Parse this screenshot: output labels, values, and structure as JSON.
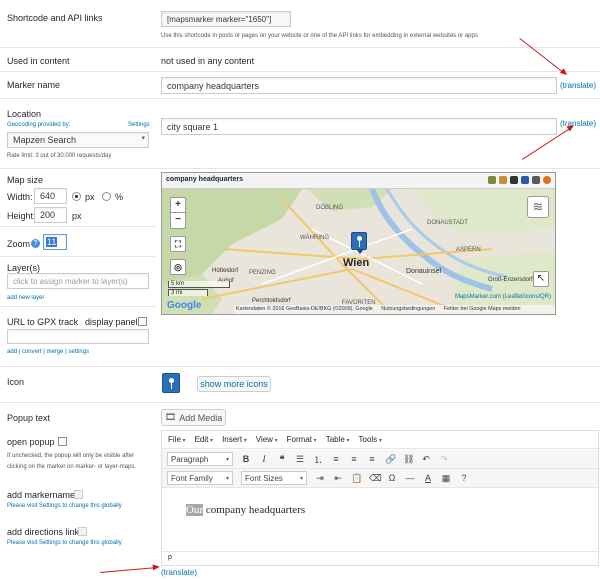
{
  "shortcode": {
    "label": "Shortcode and API links",
    "value": "[mapsmarker marker=\"1650\"]",
    "help": "Use this shortcode in posts or pages on your website or one of the API links for embedding in external websites or apps"
  },
  "used": {
    "label": "Used in content",
    "value": "not used in any content"
  },
  "marker_name": {
    "label": "Marker name",
    "value": "company headquarters",
    "translate": "(translate)"
  },
  "location": {
    "label": "Location",
    "geocoding": "Geocoding provided by:",
    "settings": "Settings",
    "provider": "Mapzen Search",
    "rate": "Rate limit: 3 out of 30.000 requests/day",
    "value": "city square 1",
    "translate": "(translate)"
  },
  "map_size": {
    "label": "Map size",
    "width_label": "Width:",
    "width": "640",
    "px": "px",
    "pct": "%",
    "height_label": "Height:",
    "height": "200",
    "height_unit": "px"
  },
  "zoom": {
    "label": "Zoom",
    "value": "11"
  },
  "layers": {
    "label": "Layer(s)",
    "placeholder": "click to assign marker to layer(s)",
    "add": "add new layer"
  },
  "gpx": {
    "label": "URL to GPX track",
    "display": "display panel",
    "links": "add | convert | merge | settings"
  },
  "map": {
    "title": "company headquarters",
    "city": "Wien",
    "scale_km": "5 km",
    "scale_mi": "3 mi",
    "attribution_left": "Kartendaten © 2016 GeoBasis-DE/BKG (©2009), Google",
    "terms": "Nutzungsbedingungen",
    "report": "Fehler bei Google Maps melden",
    "credit": "MapsMarker.com (Leaflet/icons/QR)",
    "google": "Google",
    "places": [
      "DÖBLING",
      "DONAUSTADT",
      "WÄHRING",
      "Hütteldorf",
      "PENZING",
      "Donauinsel",
      "Auhof",
      "ASPERN",
      "Groß-Enzersdorf",
      "FAVORITEN",
      "Perchtoldsdorf"
    ],
    "zoom_in": "+",
    "zoom_out": "−"
  },
  "icon": {
    "label": "Icon",
    "more": "show more icons"
  },
  "popup": {
    "label": "Popup text",
    "add_media": "Add Media",
    "open_label": "open popup",
    "open_help": "If unchecked, the popup will only be visible after clicking on the marker on marker- or layer-maps.",
    "markername": "add markername",
    "markername_help": "Please visit Settings to change this globally",
    "directions": "add directions link",
    "directions_help": "Please visit Settings to change this globally",
    "menu": [
      "File",
      "Edit",
      "Insert",
      "View",
      "Format",
      "Table",
      "Tools"
    ],
    "paragraph": "Paragraph",
    "font_family": "Font Family",
    "font_sizes": "Font Sizes",
    "content_highlight": "Our",
    "content_rest": " company headquarters",
    "status": "p",
    "translate": "(translate)"
  },
  "colors": {
    "accent": "#0073aa",
    "arrow": "#d01818",
    "marker": "#2a6fb8"
  }
}
